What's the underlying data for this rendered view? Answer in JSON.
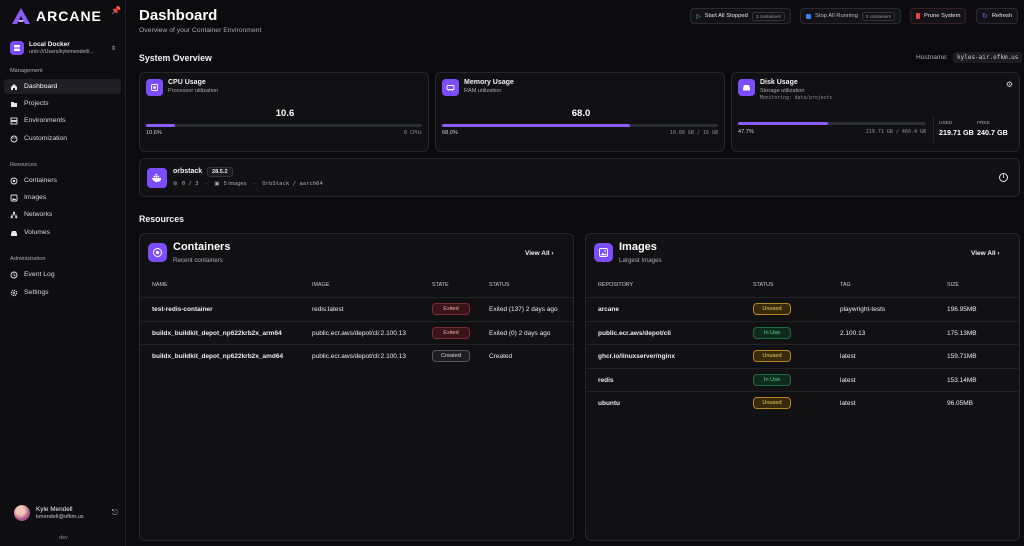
{
  "app": {
    "name": "ARCANE",
    "version": "dev"
  },
  "environment": {
    "name": "Local Docker",
    "path": "unix:///Users/kylemendell/..."
  },
  "sidebar": {
    "management_label": "Management",
    "resources_label": "Resources",
    "administration_label": "Administration",
    "management": [
      {
        "label": "Dashboard",
        "icon": "home-icon",
        "active": true
      },
      {
        "label": "Projects",
        "icon": "folder-icon"
      },
      {
        "label": "Environments",
        "icon": "server-icon"
      },
      {
        "label": "Customization",
        "icon": "palette-icon"
      }
    ],
    "resources": [
      {
        "label": "Containers",
        "icon": "container-icon"
      },
      {
        "label": "Images",
        "icon": "image-icon"
      },
      {
        "label": "Networks",
        "icon": "network-icon"
      },
      {
        "label": "Volumes",
        "icon": "volume-icon"
      }
    ],
    "administration": [
      {
        "label": "Event Log",
        "icon": "log-icon"
      },
      {
        "label": "Settings",
        "icon": "gear-icon"
      }
    ]
  },
  "user": {
    "name": "Kyle Mendell",
    "email": "kmendell@ofkm.us"
  },
  "header": {
    "title": "Dashboard",
    "subtitle": "Overview of your Container Environment",
    "start_all": {
      "label": "Start All Stopped",
      "count": "3 containers"
    },
    "stop_all": {
      "label": "Stop All Running",
      "count": "0 containers"
    },
    "prune": {
      "label": "Prune System"
    },
    "refresh": {
      "label": "Refresh"
    }
  },
  "overview": {
    "title": "System Overview",
    "hostname_label": "Hostname:",
    "hostname": "kyles-air.ofkm.us",
    "cpu": {
      "title": "CPU Usage",
      "subtitle": "Processor utilization",
      "value": "10.6",
      "percent_label": "10.6%",
      "detail": "8 CPUs",
      "fraction": 0.106
    },
    "memory": {
      "title": "Memory Usage",
      "subtitle": "RAM utilization",
      "value": "68.0",
      "percent_label": "68.0%",
      "detail": "10.88 GB / 16 GB",
      "fraction": 0.68
    },
    "disk": {
      "title": "Disk Usage",
      "subtitle": "Storage utilization",
      "monitoring": "Monitoring: data/projects",
      "percent_label": "47.7%",
      "detail": "219.71 GB / 460.4 GB",
      "used_label": "USED",
      "used": "219.71 GB",
      "free_label": "FREE",
      "free": "240.7 GB",
      "fraction": 0.477
    }
  },
  "engine": {
    "name": "orbstack",
    "version": "28.5.2",
    "containers": "0 / 3",
    "images": "5 images",
    "platform": "OrbStack / aarch64"
  },
  "resources_title": "Resources",
  "containers": {
    "title": "Containers",
    "subtitle": "Recent containers",
    "view_all": "View All",
    "columns": [
      "NAME",
      "IMAGE",
      "STATE",
      "STATUS"
    ],
    "rows": [
      {
        "name": "test-redis-container",
        "image": "redis:latest",
        "state": "Exited",
        "status": "Exited (137) 2 days ago"
      },
      {
        "name": "buildx_buildkit_depot_np622krb2x_arm64",
        "image": "public.ecr.aws/depot/cli:2.100.13",
        "state": "Exited",
        "status": "Exited (0) 2 days ago"
      },
      {
        "name": "buildx_buildkit_depot_np622krb2x_amd64",
        "image": "public.ecr.aws/depot/cli:2.100.13",
        "state": "Created",
        "status": "Created"
      }
    ]
  },
  "images": {
    "title": "Images",
    "subtitle": "Largest Images",
    "view_all": "View All",
    "columns": [
      "REPOSITORY",
      "STATUS",
      "TAG",
      "SIZE"
    ],
    "rows": [
      {
        "repository": "arcane",
        "status": "Unused",
        "tag": "playwright-tests",
        "size": "196.95MB"
      },
      {
        "repository": "public.ecr.aws/depot/cli",
        "status": "In Use",
        "tag": "2.100.13",
        "size": "175.13MB"
      },
      {
        "repository": "ghcr.io/linuxserver/nginx",
        "status": "Unused",
        "tag": "latest",
        "size": "159.71MB"
      },
      {
        "repository": "redis",
        "status": "In Use",
        "tag": "latest",
        "size": "153.14MB"
      },
      {
        "repository": "ubuntu",
        "status": "Unused",
        "tag": "latest",
        "size": "96.05MB"
      }
    ]
  },
  "colors": {
    "accent": "#7c4dff",
    "bar": "#8b5cf6",
    "exited": "#f0a4ab",
    "unused": "#f5c75a",
    "in_use": "#5fd890"
  }
}
